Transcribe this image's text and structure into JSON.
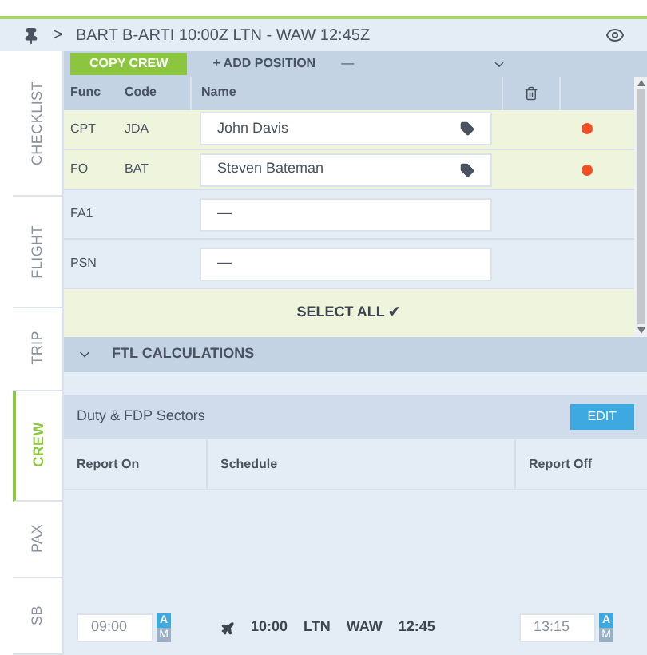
{
  "header": {
    "arrow": ">",
    "title": "BART B-ARTI 10:00Z LTN - WAW 12:45Z"
  },
  "side_tabs": [
    {
      "label": "CHECKLIST",
      "selected": false
    },
    {
      "label": "FLIGHT",
      "selected": false
    },
    {
      "label": "TRIP",
      "selected": false
    },
    {
      "label": "CREW",
      "selected": true
    },
    {
      "label": "PAX",
      "selected": false
    },
    {
      "label": "SB",
      "selected": false
    }
  ],
  "toolbar": {
    "copy_button": "COPY CREW",
    "add_button": "+ ADD POSITION",
    "dash": "—"
  },
  "crew_table": {
    "columns": [
      "Func",
      "Code",
      "Name"
    ],
    "rows": [
      {
        "func": "CPT",
        "code": "JDA",
        "name": "John Davis",
        "assigned": true,
        "color": "#f04e23"
      },
      {
        "func": "FO",
        "code": "BAT",
        "name": "Steven Bateman",
        "assigned": true,
        "color": "#f04e23"
      },
      {
        "func": "FA1",
        "name": "—",
        "assigned": false
      },
      {
        "func": "PSN",
        "name": "—",
        "assigned": false
      }
    ],
    "select_all": "SELECT ALL ✔"
  },
  "ftl": {
    "title": "FTL CALCULATIONS",
    "expanded": true,
    "sectors_label": "Duty & FDP Sectors",
    "edit_button": "EDIT",
    "columns": [
      "Report On",
      "Schedule",
      "Report Off"
    ],
    "report_on": {
      "value": "09:00",
      "spinner_up": "A",
      "spinner_down": "M"
    },
    "report_off": {
      "value": "13:15",
      "spinner_up": "A",
      "spinner_down": "M"
    },
    "schedule": [
      "10:00",
      "LTN",
      "WAW",
      "12:45"
    ]
  }
}
